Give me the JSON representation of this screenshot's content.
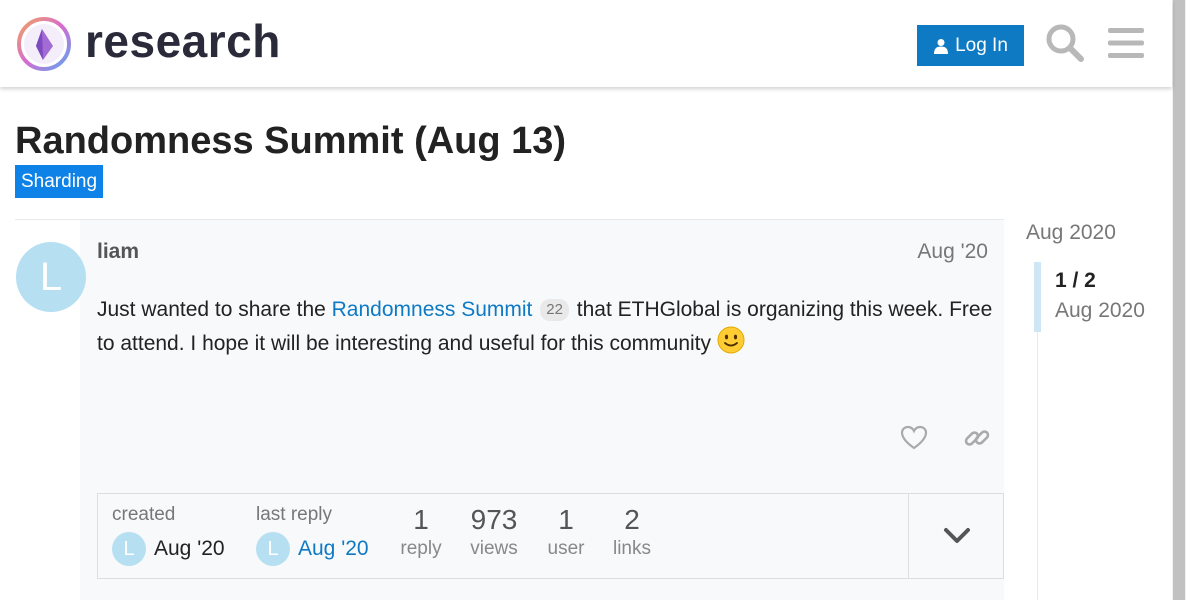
{
  "header": {
    "site_title": "research",
    "login_label": "Log In",
    "icons": [
      "logo-icon",
      "user-icon",
      "search-icon",
      "menu-icon"
    ]
  },
  "topic": {
    "title": "Randomness Summit (Aug 13)",
    "category": "Sharding"
  },
  "post": {
    "avatar_letter": "L",
    "username": "liam",
    "date": "Aug '20",
    "body_prefix": "Just wanted to share the ",
    "link_text": "Randomness Summit",
    "link_clicks": "22",
    "body_suffix": " that ETHGlobal is organizing this week. Free to attend. I hope it will be interesting and useful for this community"
  },
  "topic_map": {
    "created_label": "created",
    "created_date": "Aug '20",
    "last_reply_label": "last reply",
    "last_reply_date": "Aug '20",
    "avatar_letter": "L",
    "stats": [
      {
        "num": "1",
        "label": "reply"
      },
      {
        "num": "973",
        "label": "views"
      },
      {
        "num": "1",
        "label": "user"
      },
      {
        "num": "2",
        "label": "links"
      }
    ]
  },
  "timeline": {
    "top_date": "Aug 2020",
    "position": "1 / 2",
    "current_date": "Aug 2020"
  },
  "colors": {
    "accent": "#0e7ac4",
    "category": "#0e82e6",
    "avatar": "#b6e0f2"
  }
}
